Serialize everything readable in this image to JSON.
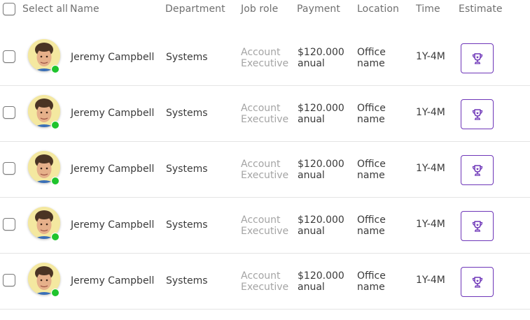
{
  "header": {
    "select_all": "Select all",
    "name": "Name",
    "department": "Department",
    "job_role": "Job role",
    "payment": "Payment",
    "location": "Location",
    "time": "Time",
    "estimate": "Estimate"
  },
  "rows": [
    {
      "name": "Jeremy Campbell",
      "department": "Systems",
      "role_1": "Account",
      "role_2": "Executive",
      "pay_1": "$120.000",
      "pay_2": "anual",
      "loc_1": "Office",
      "loc_2": "name",
      "time": "1Y-4M"
    },
    {
      "name": "Jeremy Campbell",
      "department": "Systems",
      "role_1": "Account",
      "role_2": "Executive",
      "pay_1": "$120.000",
      "pay_2": "anual",
      "loc_1": "Office",
      "loc_2": "name",
      "time": "1Y-4M"
    },
    {
      "name": "Jeremy Campbell",
      "department": "Systems",
      "role_1": "Account",
      "role_2": "Executive",
      "pay_1": "$120.000",
      "pay_2": "anual",
      "loc_1": "Office",
      "loc_2": "name",
      "time": "1Y-4M"
    },
    {
      "name": "Jeremy Campbell",
      "department": "Systems",
      "role_1": "Account",
      "role_2": "Executive",
      "pay_1": "$120.000",
      "pay_2": "anual",
      "loc_1": "Office",
      "loc_2": "name",
      "time": "1Y-4M"
    },
    {
      "name": "Jeremy Campbell",
      "department": "Systems",
      "role_1": "Account",
      "role_2": "Executive",
      "pay_1": "$120.000",
      "pay_2": "anual",
      "loc_1": "Office",
      "loc_2": "name",
      "time": "1Y-4M"
    }
  ],
  "colors": {
    "accent": "#6e36b8",
    "online_status": "#1fc42d",
    "muted_text": "#a4a4a4"
  },
  "icons": {
    "estimate": "trophy-icon",
    "status": "online-status-icon"
  }
}
